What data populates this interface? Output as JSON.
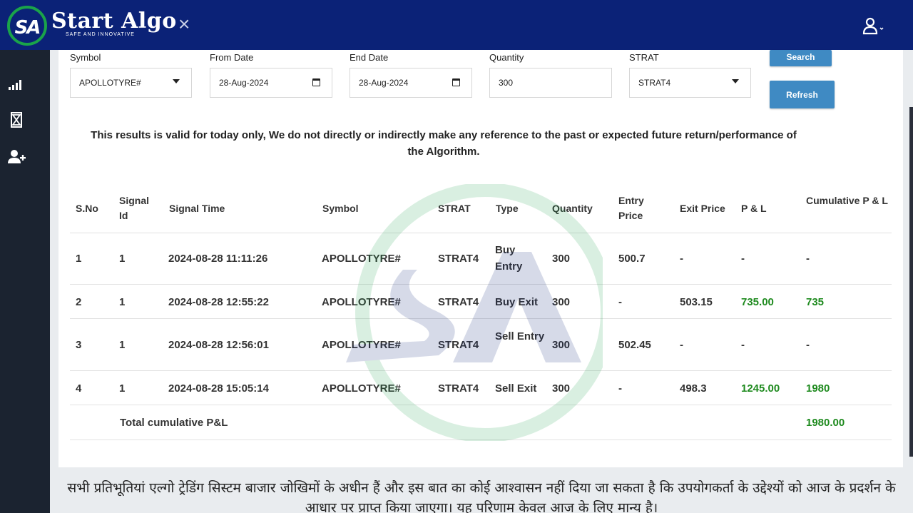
{
  "header": {
    "logo_text": "SA",
    "brand": "Start Algo",
    "tagline": "SAFE AND INNOVATIVE",
    "close_glyph": "×",
    "user_icon": "user-icon",
    "bg_color": "#0b2277",
    "accent_color": "#1aa34a"
  },
  "sidebar": {
    "items": [
      {
        "icon": "signal-bars-icon"
      },
      {
        "icon": "hourglass-icon"
      },
      {
        "icon": "add-user-icon"
      }
    ]
  },
  "filters": {
    "symbol": {
      "label": "Symbol",
      "value": "APOLLOTYRE#"
    },
    "from_date": {
      "label": "From Date",
      "value": "28-Aug-2024"
    },
    "end_date": {
      "label": "End Date",
      "value": "28-Aug-2024"
    },
    "quantity": {
      "label": "Quantity",
      "value": "300"
    },
    "strat": {
      "label": "STRAT",
      "value": "STRAT4"
    },
    "search_label": "Search",
    "refresh_label": "Refresh"
  },
  "disclaimer": "This results is valid for today only, We do not directly or indirectly make any reference to the past or expected future return/performance of the Algorithm.",
  "table": {
    "headers": [
      "S.No",
      "Signal Id",
      "Signal Time",
      "Symbol",
      "STRAT",
      "Type",
      "Quantity",
      "Entry Price",
      "Exit Price",
      "P & L",
      "Cumulative P & L"
    ],
    "rows": [
      [
        "1",
        "1",
        "2024-08-28 11:11:26",
        "APOLLOTYRE#",
        "STRAT4",
        "Buy Entry",
        "300",
        "500.7",
        "-",
        "-",
        "-"
      ],
      [
        "2",
        "1",
        "2024-08-28 12:55:22",
        "APOLLOTYRE#",
        "STRAT4",
        "Buy Exit",
        "300",
        "-",
        "503.15",
        "735.00",
        "735"
      ],
      [
        "3",
        "1",
        "2024-08-28 12:56:01",
        "APOLLOTYRE#",
        "STRAT4",
        "Sell Entry",
        "300",
        "502.45",
        "-",
        "-",
        "-"
      ],
      [
        "4",
        "1",
        "2024-08-28 15:05:14",
        "APOLLOTYRE#",
        "STRAT4",
        "Sell Exit",
        "300",
        "-",
        "498.3",
        "1245.00",
        "1980"
      ]
    ],
    "total_label": "Total cumulative P&L",
    "total_value": "1980.00",
    "profit_color": "#1e8a1e"
  },
  "footer_hindi": "सभी प्रतिभूतियां एल्गो ट्रेडिंग सिस्टम बाजार जोखिमों के अधीन हैं और इस बात का कोई आश्वासन नहीं दिया जा सकता है कि उपयोगकर्ता के उद्देश्यों को आज के प्रदर्शन के आधार पर प्राप्त किया जाएगा। यह परिणाम केवल आज के लिए मान्य है।"
}
